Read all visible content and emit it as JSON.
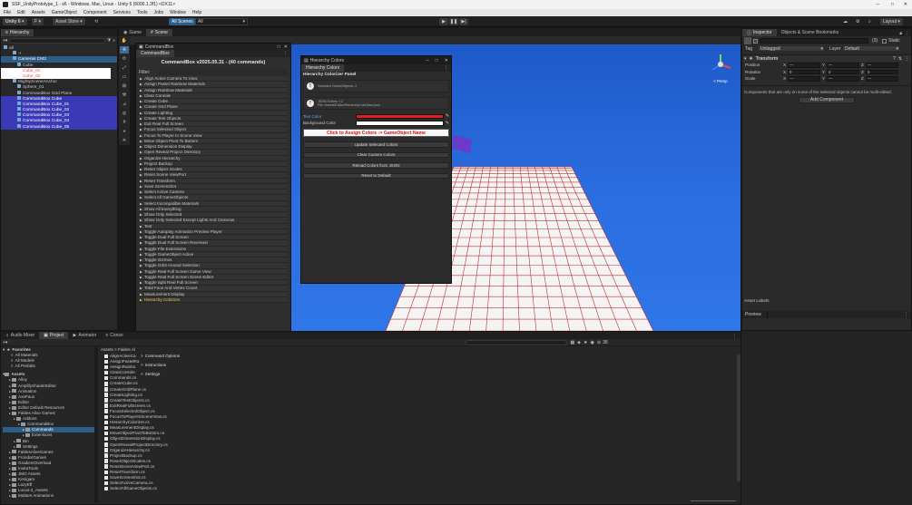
{
  "window_title": "SSF_UnityPrototype_1 - x6 - Windows, Mac, Linux - Unity 6 (6000.1.3f1) <DX11>",
  "menu": [
    "File",
    "Edit",
    "Assets",
    "GameObject",
    "Component",
    "Services",
    "Tools",
    "Jobs",
    "Window",
    "Help"
  ],
  "toolbar": {
    "account": "Unity 6",
    "cloud": "F",
    "asset_store": "Asset Store",
    "all_scenes": "All Scenes",
    "scene_dropdown": "All",
    "layers": "Layers",
    "layout": "Layout"
  },
  "hierarchy": {
    "tab": "Hierarchy",
    "search_placeholder": "All",
    "items": [
      {
        "label": "all",
        "indent": 0,
        "style": "root"
      },
      {
        "label": "-r",
        "indent": 2,
        "style": "normal"
      },
      {
        "label": "Cameras CM2",
        "indent": 2,
        "style": "selected"
      },
      {
        "label": "Cube",
        "indent": 3,
        "style": "normal"
      },
      {
        "label": "Cube_01",
        "indent": 3,
        "style": "red"
      },
      {
        "label": "Cube_02",
        "indent": 3,
        "style": "red"
      },
      {
        "label": "MightySceneAnchor",
        "indent": 2,
        "style": "normal"
      },
      {
        "label": "Sphere_01",
        "indent": 3,
        "style": "normal"
      },
      {
        "label": "CommandBox Grid Plane",
        "indent": 3,
        "style": "normal"
      },
      {
        "label": "CommandBox Cube",
        "indent": 3,
        "style": "blue"
      },
      {
        "label": "CommandBox Cube_01",
        "indent": 3,
        "style": "blue"
      },
      {
        "label": "CommandBox Cube_02",
        "indent": 3,
        "style": "blue"
      },
      {
        "label": "CommandBox Cube_03",
        "indent": 3,
        "style": "blue"
      },
      {
        "label": "CommandBox Cube_04",
        "indent": 3,
        "style": "blue"
      },
      {
        "label": "CommandBox Cube_05",
        "indent": 3,
        "style": "blue"
      }
    ]
  },
  "scene_tabs": {
    "game": "Game",
    "scene": "Scene",
    "persp": "< Persp"
  },
  "commandbox": {
    "window_tab": "CommandBox",
    "inner_tab": "CommandBox",
    "header": "CommandBox v2025.05.31 - (40 commands)",
    "filter_label": "Filter:",
    "commands": [
      "Align Active Camera To View",
      "Assign Pastel Rainbow Materials",
      "Assign Rainbow Materials",
      "Clear Console",
      "Create Cube",
      "Create Grid Plane",
      "Create Lighting",
      "Create Test Objects",
      "Exit Real Full Screen",
      "Focus Selected Object",
      "Focus To Player In Scene View",
      "Move Object Pivot To Bottom",
      "Object Dimension Display",
      "Open Reveal Project Directory",
      "Organize Hierarchy",
      "Project Backup",
      "Reset Object Scales",
      "Reset Scene ViewPort",
      "Reset Transform",
      "Save Screenshot",
      "Select Active Camera",
      "Select All GameObjects",
      "Select Incompatible Materials",
      "Show All Everything",
      "Show Only Selected",
      "Show Only Selected Except Lights And Cameras",
      "Test",
      "Toggle Autoplay Animation Preview Player",
      "Toggle Dual Full Screen",
      "Toggle Dual Full Screen Reversed",
      "Toggle File Extensions",
      "Toggle GameObject Active",
      "Toggle Gizmos",
      "Toggle Orbit Around Selection",
      "Toggle Real Full Screen Game View",
      "Toggle Real Full Screen Scene Editor",
      "Toggle Split Real Full Screen",
      "Total Face And Vertex Count",
      "Measurement Display",
      "Hierarchy Colorizer"
    ],
    "highlighted": "Hierarchy Colorizer"
  },
  "hiercolors": {
    "window_title": "Hierarchy Colors",
    "tab": "Hierarchy Colors",
    "panel_title": "Hierarchy Colorizer Panel",
    "info_selected": "Selected GameObjects: 2",
    "info_json_1": "JSON Entries: 12",
    "info_json_2": "File: Assets/Editor/HierarchyColorData.json",
    "text_color_label": "Text Color",
    "bg_color_label": "Background Color",
    "text_color": "#e31c1c",
    "bg_color": "#ffffff",
    "assign_label": "Click to Assign Colors -> GameObject Name",
    "btn_update": "Update Selected Colors",
    "btn_clear": "Clear Custom Colors",
    "btn_reload": "Reload Colors from JSON",
    "btn_reset": "Reset to Default"
  },
  "inspector": {
    "tab1": "Inspector",
    "tab2": "Objects & Scene Bookmarks",
    "count": "(3)",
    "static_label": "Static",
    "tag_label": "Tag",
    "tag_value": "Untagged",
    "layer_label": "Layer",
    "layer_value": "Default",
    "transform_label": "Transform",
    "rows": [
      {
        "label": "Position",
        "x": "X",
        "xv": "—",
        "y": "Y",
        "yv": "—",
        "z": "Z",
        "zv": "—"
      },
      {
        "label": "Rotation",
        "x": "X",
        "xv": "0",
        "y": "Y",
        "yv": "0",
        "z": "Z",
        "zv": "0"
      },
      {
        "label": "Scale",
        "x": "X",
        "xv": "—",
        "y": "Y",
        "yv": "—",
        "z": "Z",
        "zv": "—"
      }
    ],
    "note": "Components that are only on some of the selected objects cannot be multi-edited.",
    "add_component": "Add Component",
    "asset_labels": "Asset Labels",
    "preview": "Preview"
  },
  "bottom_tabs": [
    "Audio Mixer",
    "Project",
    "Animator",
    "Conso"
  ],
  "favorites": {
    "label": "Favorites",
    "items": [
      "All Materials",
      "All Models",
      "All Prefabs"
    ]
  },
  "assets_tree": {
    "label": "Assets",
    "items": [
      {
        "label": "Alloy",
        "indent": 1
      },
      {
        "label": "AmplifyShaderEditor",
        "indent": 1
      },
      {
        "label": "Animation",
        "indent": 1
      },
      {
        "label": "AxeFaux",
        "indent": 1
      },
      {
        "label": "Editor",
        "indent": 1
      },
      {
        "label": "Editor Default Resources",
        "indent": 1
      },
      {
        "label": "Fables Alive Games",
        "indent": 1
      },
      {
        "label": "Addons",
        "indent": 2
      },
      {
        "label": "CommandBox",
        "indent": 3
      },
      {
        "label": "Commands",
        "indent": 4,
        "selected": true
      },
      {
        "label": "Extensions",
        "indent": 4
      },
      {
        "label": "Bin",
        "indent": 2
      },
      {
        "label": "Settings",
        "indent": 2
      },
      {
        "label": "FablesAliveGames",
        "indent": 1
      },
      {
        "label": "FrondorGames",
        "indent": 1
      },
      {
        "label": "GradientOverload",
        "indent": 1
      },
      {
        "label": "InukaTools",
        "indent": 1
      },
      {
        "label": "JMO Assets",
        "indent": 1
      },
      {
        "label": "Kenigam",
        "indent": 1
      },
      {
        "label": "LazyEff",
        "indent": 1
      },
      {
        "label": "Lucus-3_Assets",
        "indent": 1
      },
      {
        "label": "Mattars Animations",
        "indent": 1
      }
    ]
  },
  "breadcrumb": "Assets > Fables Al",
  "context_menu": [
    "Command Options",
    "Instructions",
    "Settings"
  ],
  "files": [
    "AlignActiveCa",
    "AssignPastelRa",
    "AssignRainbo",
    "ClearConsole",
    "Commands.cs",
    "CreateCube.cs",
    "CreateGridPlane.cs",
    "CreateLighting.cs",
    "CreateTestObjects.cs",
    "ExitRealFullScreen.cs",
    "FocusSelectedObject.cs",
    "FocusToPlayerInSceneView.cs",
    "HierarchyColorizer.cs",
    "MeasurementDisplay.cs",
    "MoveObjectPivotToBottom.cs",
    "ObjectDimensionDisplay.cs",
    "OpenRevealProjectDirectory.cs",
    "OrganizeHierarchy.cs",
    "ProjectBackup.cs",
    "ResetObjectScales.cs",
    "ResetSceneViewPort.cs",
    "ResetTransform.cs",
    "SaveScreenshot.cs",
    "SelectActiveCamera.cs",
    "SelectAllGameObjects.cs"
  ],
  "project_count": "38"
}
